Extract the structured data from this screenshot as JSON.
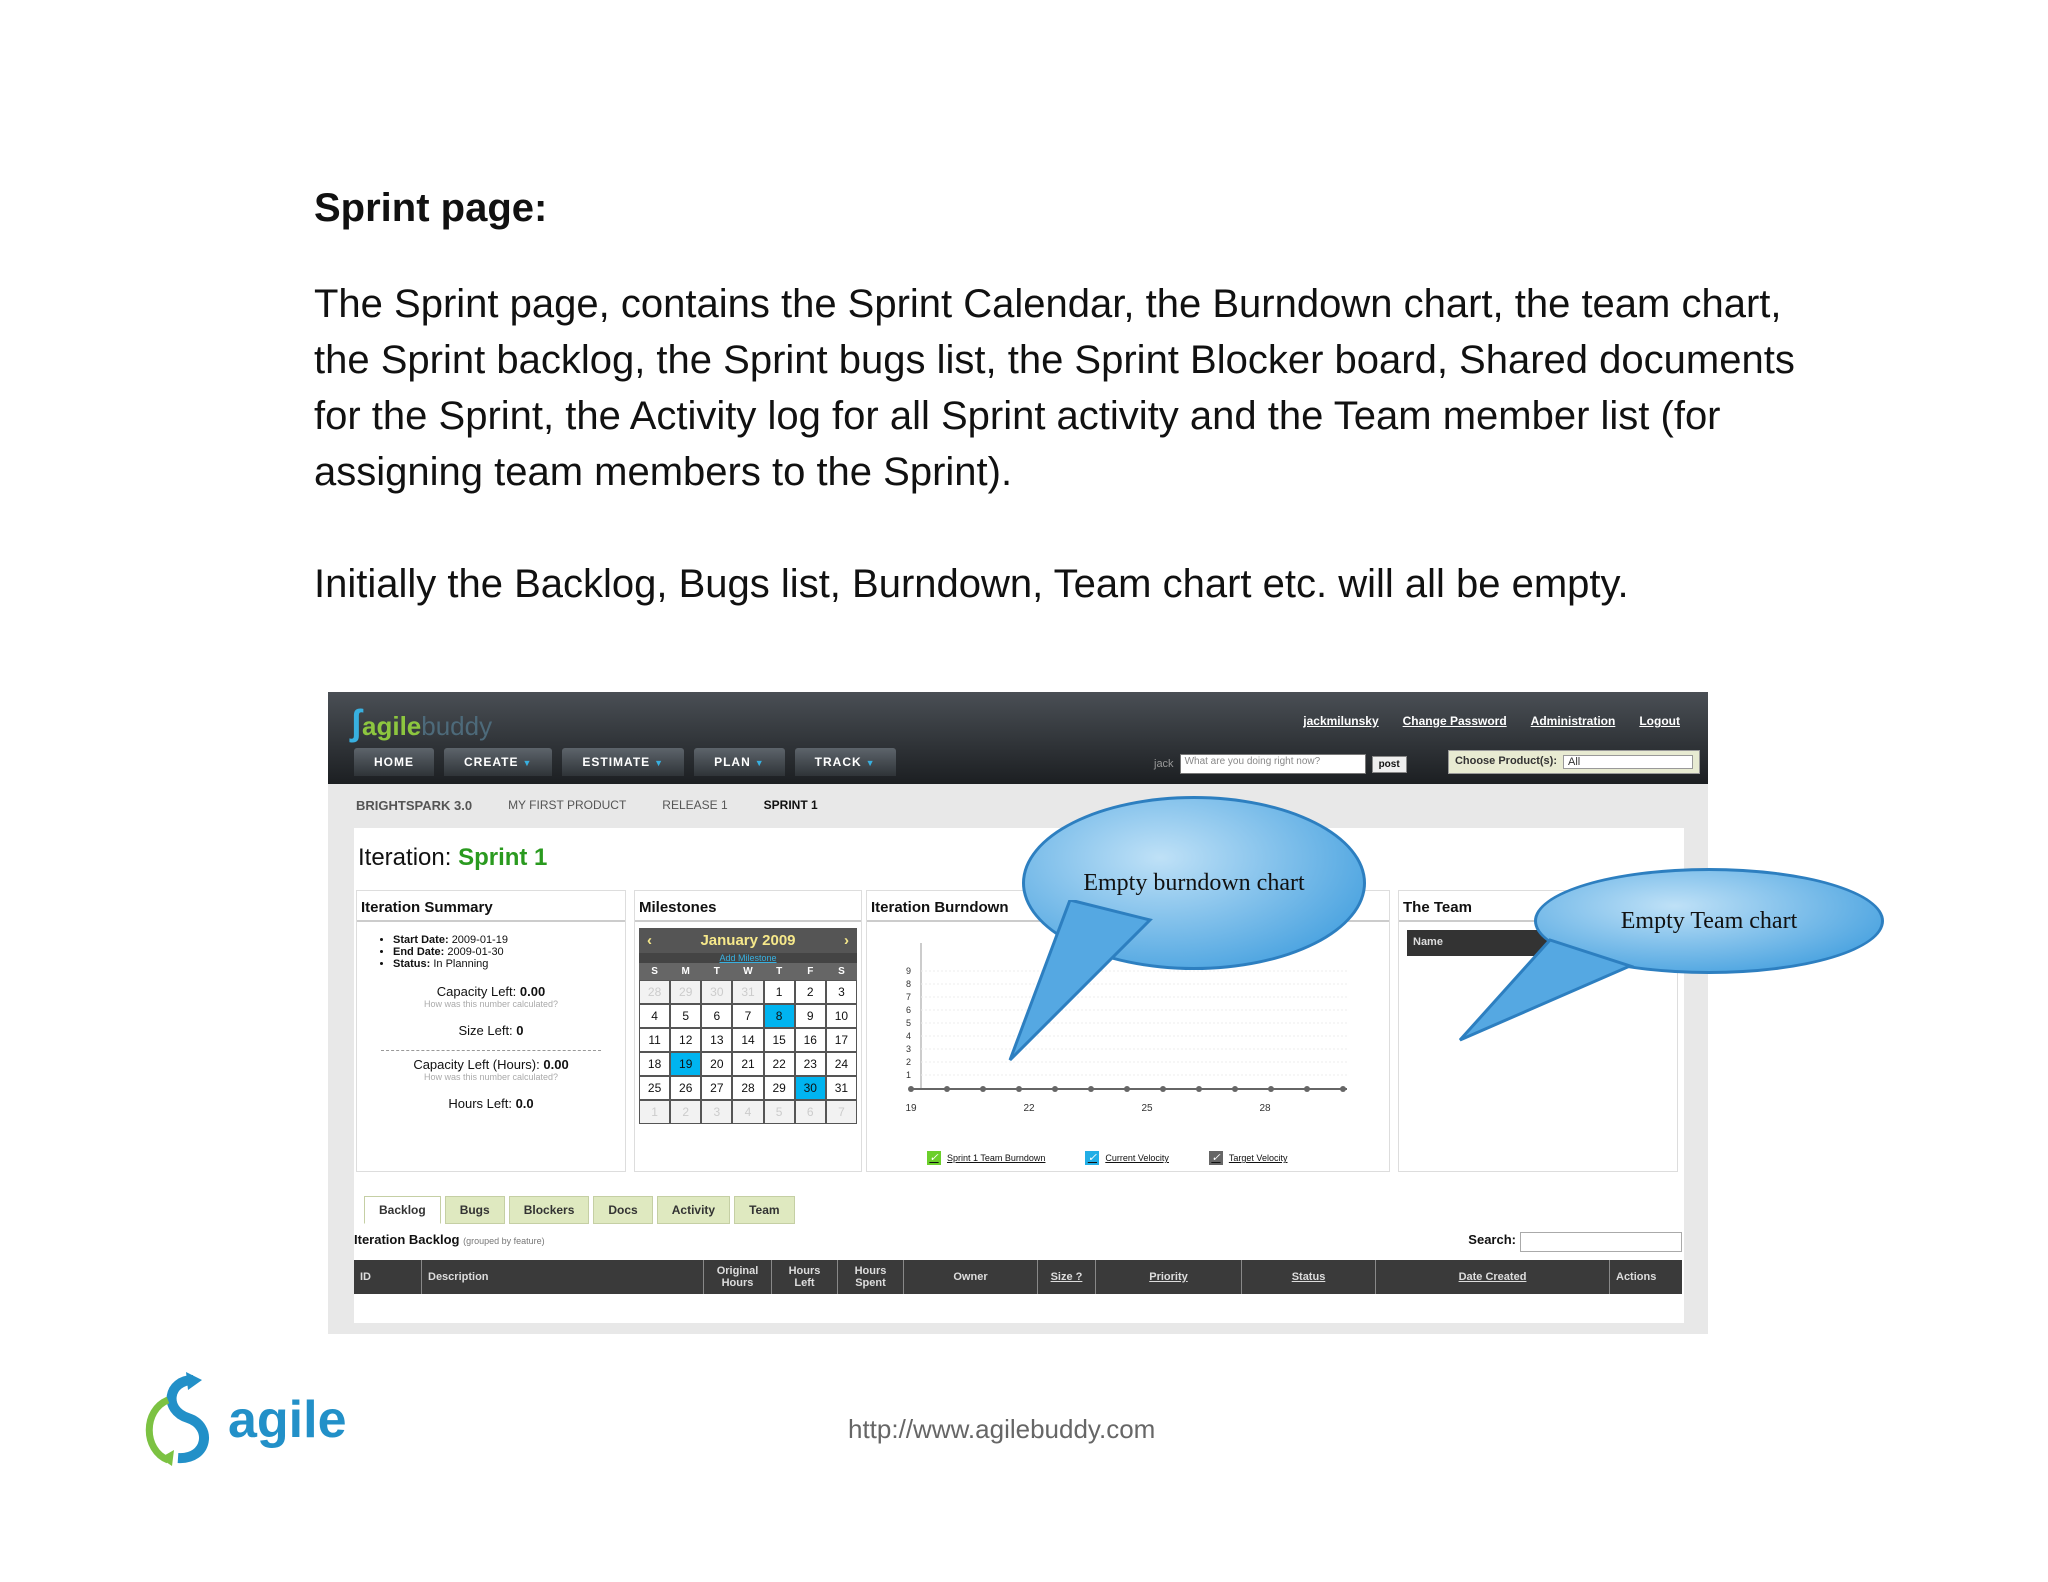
{
  "doc": {
    "heading": "Sprint page:",
    "para1": "The Sprint page, contains the Sprint Calendar, the Burndown chart, the team chart, the Sprint backlog, the Sprint bugs list, the Sprint Blocker board, Shared documents for the Sprint, the Activity log for all Sprint activity and the Team member list (for assigning team members to the Sprint).",
    "para2": "Initially the Backlog, Bugs list, Burndown, Team chart etc. will all be empty.",
    "footer_url": "http://www.agilebuddy.com",
    "footer_logo_text": "agile"
  },
  "app": {
    "logo_a": "agile",
    "logo_b": "buddy",
    "toplinks": [
      "jackmilunsky",
      "Change Password",
      "Administration",
      "Logout"
    ],
    "nav": [
      "HOME",
      "CREATE",
      "ESTIMATE",
      "PLAN",
      "TRACK"
    ],
    "status_user": "jack",
    "status_placeholder": "What are you doing right now?",
    "post_label": "post",
    "product_label": "Choose Product(s):",
    "product_value": "All",
    "breadcrumbs": [
      "BRIGHTSPARK 3.0",
      "MY FIRST PRODUCT",
      "RELEASE 1",
      "SPRINT 1"
    ],
    "iteration_label": "Iteration:",
    "iteration_name": "Sprint 1",
    "summary": {
      "title": "Iteration Summary",
      "start_label": "Start Date:",
      "start": "2009-01-19",
      "end_label": "End Date:",
      "end": "2009-01-30",
      "status_label": "Status:",
      "status": "In Planning",
      "cap_label": "Capacity Left:",
      "cap": "0.00",
      "hint": "How was this number calculated?",
      "size_label": "Size Left:",
      "size": "0",
      "caph_label": "Capacity Left (Hours):",
      "caph": "0.00",
      "hours_label": "Hours Left:",
      "hours": "0.0"
    },
    "milestones": {
      "title": "Milestones",
      "month": "January 2009",
      "add": "Add Milestone",
      "dow": [
        "S",
        "M",
        "T",
        "W",
        "T",
        "F",
        "S"
      ],
      "weeks": [
        [
          "28",
          "29",
          "30",
          "31",
          "1",
          "2",
          "3"
        ],
        [
          "4",
          "5",
          "6",
          "7",
          "8",
          "9",
          "10"
        ],
        [
          "11",
          "12",
          "13",
          "14",
          "15",
          "16",
          "17"
        ],
        [
          "18",
          "19",
          "20",
          "21",
          "22",
          "23",
          "24"
        ],
        [
          "25",
          "26",
          "27",
          "28",
          "29",
          "30",
          "31"
        ],
        [
          "1",
          "2",
          "3",
          "4",
          "5",
          "6",
          "7"
        ]
      ]
    },
    "burndown_title": "Iteration Burndown",
    "legend": [
      "Sprint 1 Team Burndown",
      "Current Velocity",
      "Target Velocity"
    ],
    "team_title": "The Team",
    "team_col": "Name",
    "tabs": [
      "Backlog",
      "Bugs",
      "Blockers",
      "Docs",
      "Activity",
      "Team"
    ],
    "backlog_title": "Iteration Backlog",
    "backlog_sub": "(grouped by feature)",
    "search_label": "Search:",
    "columns": [
      "ID",
      "Description",
      "Original Hours",
      "Hours Left",
      "Hours Spent",
      "Owner",
      "Size ?",
      "Priority",
      "Status",
      "Date Created",
      "Actions"
    ]
  },
  "chart_data": {
    "type": "line",
    "title": "Iteration Burndown",
    "x_ticks": [
      "19",
      "22",
      "25",
      "28"
    ],
    "y_ticks": [
      "1",
      "2",
      "3",
      "4",
      "5",
      "6",
      "7",
      "8",
      "9"
    ],
    "series": [
      {
        "name": "Sprint 1 Team Burndown",
        "values": []
      },
      {
        "name": "Current Velocity",
        "values": []
      },
      {
        "name": "Target Velocity",
        "values": []
      }
    ],
    "note_points_y": 0
  },
  "callouts": [
    "Empty burndown chart",
    "Empty Team chart"
  ]
}
